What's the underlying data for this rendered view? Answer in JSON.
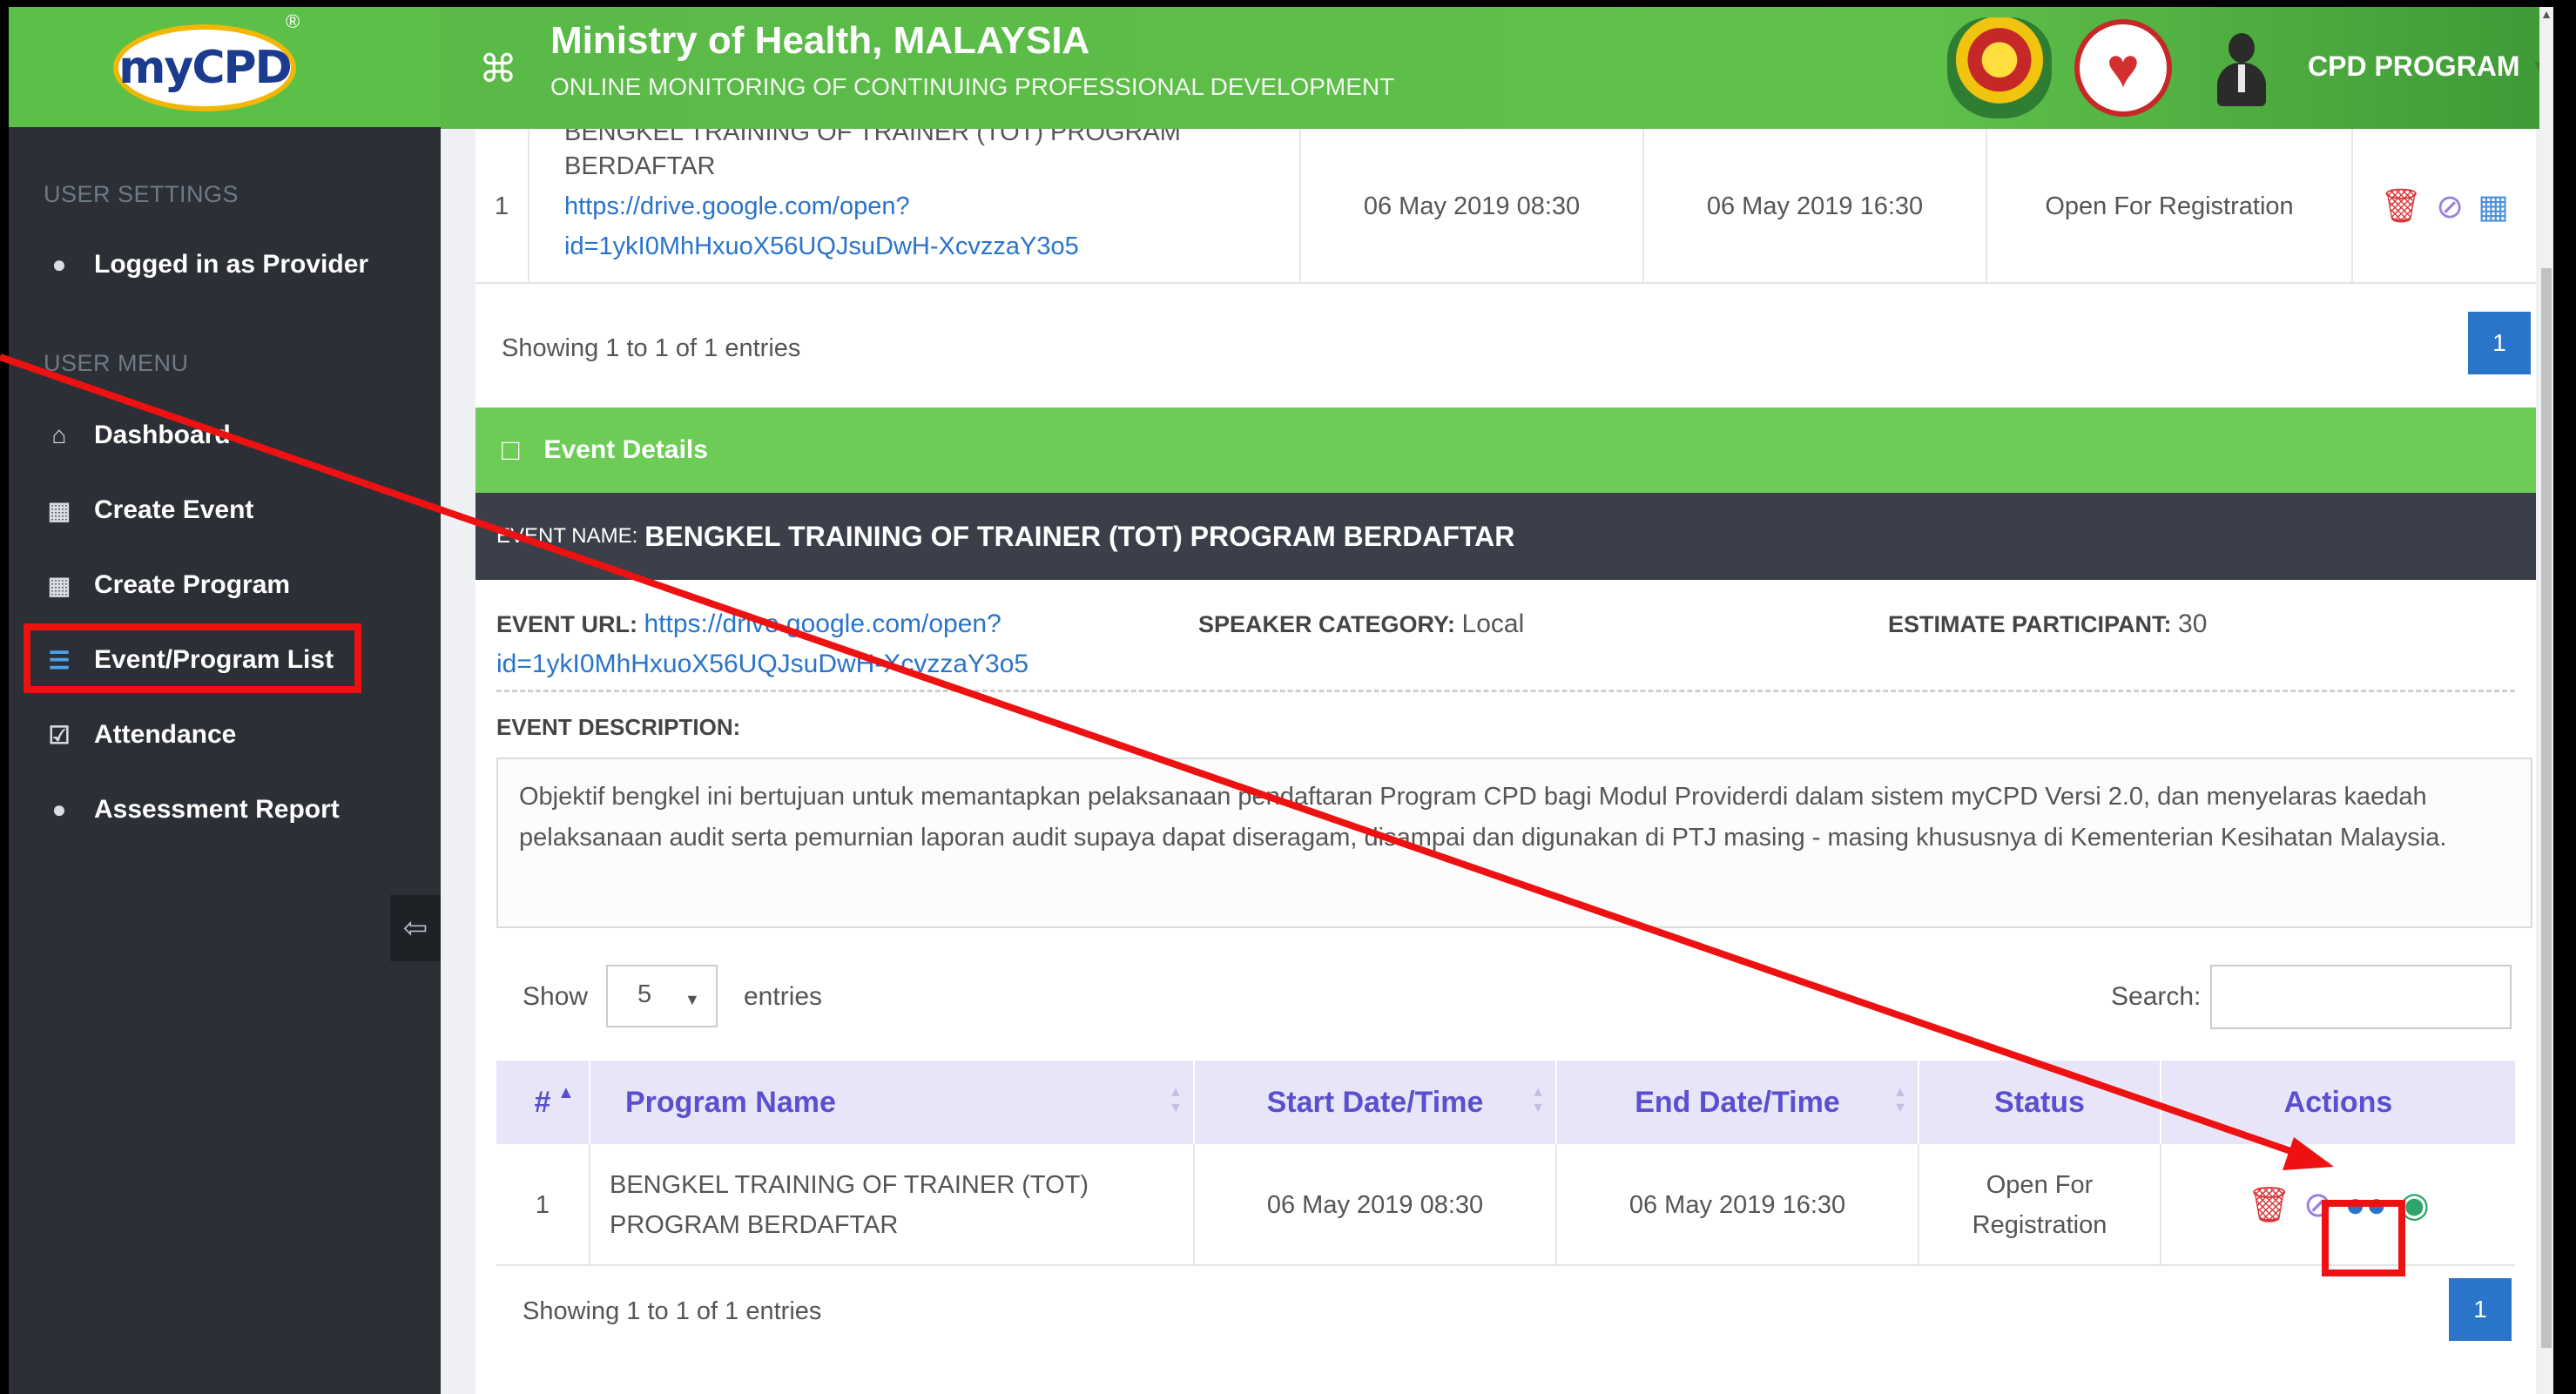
{
  "logo": {
    "text": "myCPD",
    "reg": "®"
  },
  "header": {
    "title": "Ministry of Health, MALAYSIA",
    "subtitle": "ONLINE MONITORING OF CONTINUING PROFESSIONAL DEVELOPMENT",
    "user_label": "CPD PROGRAM"
  },
  "sidebar": {
    "settings_heading": "USER SETTINGS",
    "logged_in": "Logged in as Provider",
    "menu_heading": "USER MENU",
    "items": [
      {
        "label": "Dashboard",
        "icon": "home-icon"
      },
      {
        "label": "Create Event",
        "icon": "calendar-icon"
      },
      {
        "label": "Create Program",
        "icon": "calendar-icon"
      },
      {
        "label": "Event/Program List",
        "icon": "list-icon"
      },
      {
        "label": "Attendance",
        "icon": "checkbox-icon"
      },
      {
        "label": "Assessment Report",
        "icon": "user-icon"
      }
    ]
  },
  "top_table": {
    "row": {
      "num": "1",
      "name_cut": "BENGKEL TRAINING OF TRAINER (TOT) PROGRAM",
      "name_end": "BERDAFTAR",
      "url_line1": "https://drive.google.com/open?",
      "url_line2": "id=1ykI0MhHxuoX56UQJsuDwH-XcvzzaY3o5",
      "start": "06 May 2019 08:30",
      "end": "06 May 2019 16:30",
      "status": "Open For Registration"
    },
    "info": "Showing 1 to 1 of 1 entries",
    "page": "1"
  },
  "event_details": {
    "title": "Event Details",
    "name_label": "EVENT NAME:",
    "name": "BENGKEL TRAINING OF TRAINER (TOT) PROGRAM BERDAFTAR",
    "url_label": "EVENT URL:",
    "url_line1": "https://drive.google.com/open?",
    "url_line2": "id=1ykI0MhHxuoX56UQJsuDwH-XcvzzaY3o5",
    "speaker_label": "SPEAKER CATEGORY:",
    "speaker": "Local",
    "estimate_label": "ESTIMATE PARTICIPANT:",
    "estimate": "30",
    "desc_label": "EVENT DESCRIPTION:",
    "description": "Objektif bengkel ini bertujuan untuk memantapkan pelaksanaan pendaftaran Program CPD bagi Modul Providerdi dalam sistem myCPD Versi 2.0, dan menyelaras kaedah pelaksanaan audit serta pemurnian laporan audit supaya dapat diseragam, disampai dan digunakan di PTJ masing - masing khususnya di Kementerian Kesihatan Malaysia."
  },
  "program_table": {
    "show_label": "Show",
    "length_value": "5",
    "entries_label": "entries",
    "search_label": "Search:",
    "search_value": "",
    "columns": [
      "#",
      "Program Name",
      "Start Date/Time",
      "End Date/Time",
      "Status",
      "Actions"
    ],
    "row": {
      "num": "1",
      "name_line1": "BENGKEL TRAINING OF TRAINER (TOT)",
      "name_line2": "PROGRAM BERDAFTAR",
      "start": "06 May 2019 08:30",
      "end": "06 May 2019 16:30",
      "status_line1": "Open For",
      "status_line2": "Registration"
    },
    "info": "Showing 1 to 1 of 1 entries",
    "page": "1"
  },
  "colors": {
    "header_green": "#5fc14a",
    "sidebar_bg": "#2c2f36",
    "link_blue": "#2a74c9",
    "table_header": "#e8e5f8",
    "annotation_red": "#ee1111"
  }
}
